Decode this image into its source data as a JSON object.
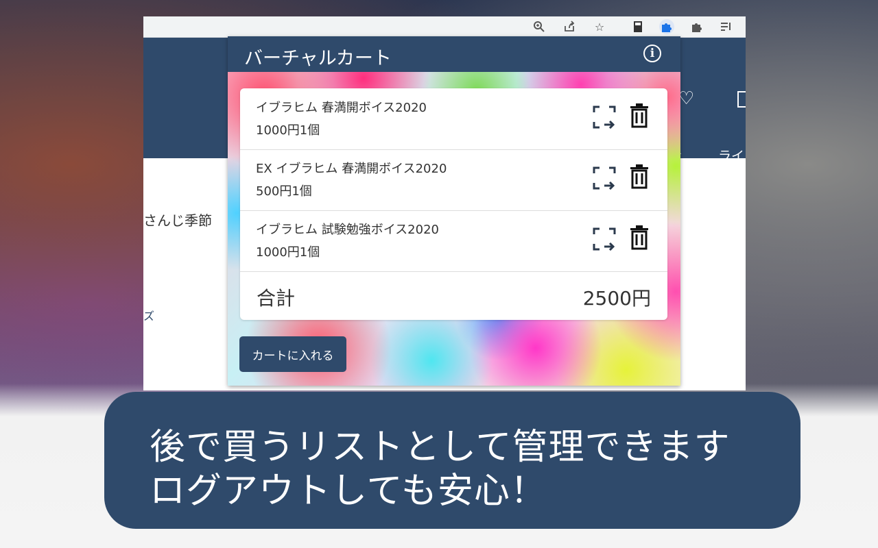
{
  "browser": {
    "toolbar_icons": [
      "zoom-icon",
      "share-icon",
      "star-icon",
      "book-icon",
      "puzzle-active-icon",
      "puzzle-icon",
      "playlist-icon"
    ]
  },
  "site": {
    "nav_partial": "ライ",
    "body_text": "さんじ季節",
    "body_mark": "ズ"
  },
  "popup": {
    "title": "バーチャルカート",
    "items": [
      {
        "name": "イブラヒム 春満開ボイス2020",
        "meta": "1000円1個"
      },
      {
        "name": "EX イブラヒム 春満開ボイス2020",
        "meta": "500円1個"
      },
      {
        "name": "イブラヒム 試験勉強ボイス2020",
        "meta": "1000円1個"
      }
    ],
    "total_label": "合計",
    "total_value": "2500円",
    "add_button": "カートに入れる"
  },
  "caption": {
    "line1": "後で買うリストとして管理できます",
    "line2": "ログアウトしても安心！"
  },
  "colors": {
    "primary": "#2f4a6b",
    "card_bg": "#ffffff",
    "text": "#333333"
  }
}
